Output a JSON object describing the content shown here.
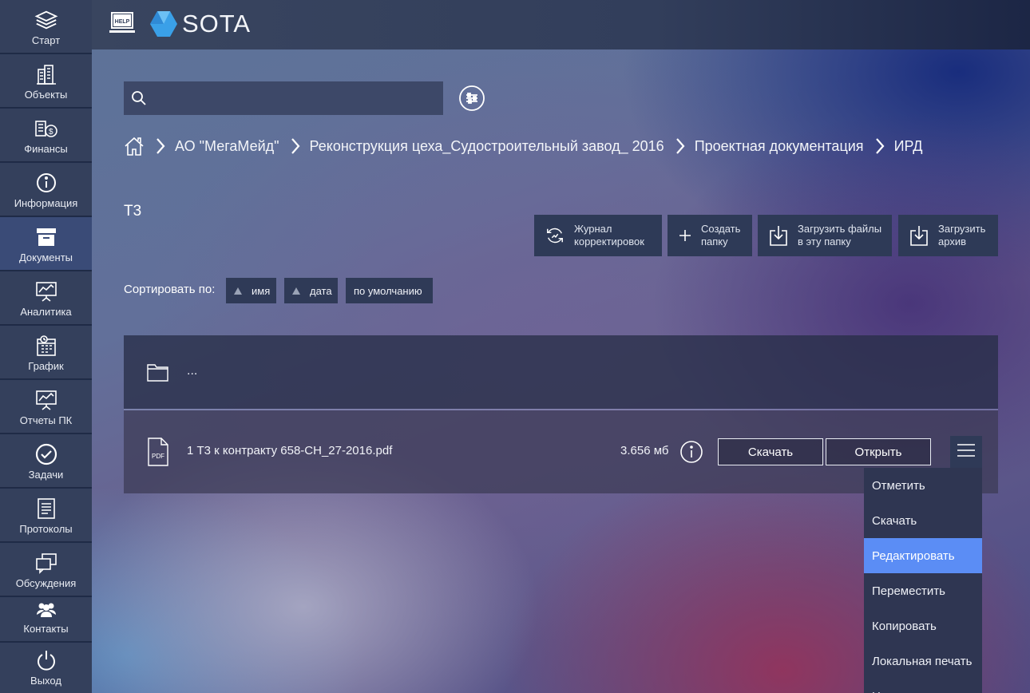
{
  "sidebar": {
    "items": [
      {
        "label": "Старт",
        "icon": "layers-icon"
      },
      {
        "label": "Объекты",
        "icon": "buildings-icon"
      },
      {
        "label": "Финансы",
        "icon": "finance-icon"
      },
      {
        "label": "Информация",
        "icon": "info-icon"
      },
      {
        "label": "Документы",
        "icon": "archive-box-icon"
      },
      {
        "label": "Аналитика",
        "icon": "presentation-chart-icon"
      },
      {
        "label": "График",
        "icon": "calendar-clock-icon"
      },
      {
        "label": "Отчеты ПК",
        "icon": "presentation-chart-icon"
      },
      {
        "label": "Задачи",
        "icon": "check-circle-icon"
      },
      {
        "label": "Протоколы",
        "icon": "document-list-icon"
      },
      {
        "label": "Обсуждения",
        "icon": "chat-windows-icon"
      },
      {
        "label": "Контакты",
        "icon": "people-icon"
      },
      {
        "label": "Выход",
        "icon": "power-icon"
      }
    ],
    "active_index": 4
  },
  "header": {
    "help_label": "HELP",
    "logo_text": "SOTA",
    "brand_color": "#3aa0e8"
  },
  "search": {
    "value": "",
    "placeholder": ""
  },
  "breadcrumb": [
    "АО \"МегаМейд\"",
    "Реконструкция цеха_Судостроительный завод_ 2016",
    "Проектная документация",
    "ИРД"
  ],
  "folder": {
    "title": "Т3"
  },
  "toolbar": {
    "journal": "Журнал\nкорректировок",
    "create_folder": "Создать\nпапку",
    "upload_files": "Загрузить файлы\nв эту папку",
    "upload_archive": "Загрузить\nархив"
  },
  "sort": {
    "label": "Сортировать по:",
    "options": [
      "имя",
      "дата",
      "по умолчанию"
    ]
  },
  "files": {
    "parent_label": "...",
    "items": [
      {
        "name": "1 Т3 к контракту 658-СН_27-2016.pdf",
        "size": "3.656 мб",
        "type_label": "PDF",
        "download_label": "Скачать",
        "open_label": "Открыть"
      }
    ]
  },
  "context_menu": {
    "items": [
      "Отметить",
      "Скачать",
      "Редактировать",
      "Переместить",
      "Копировать",
      "Локальная печать",
      "Н"
    ],
    "active_index": 2,
    "accent_color": "#5b8df5"
  }
}
